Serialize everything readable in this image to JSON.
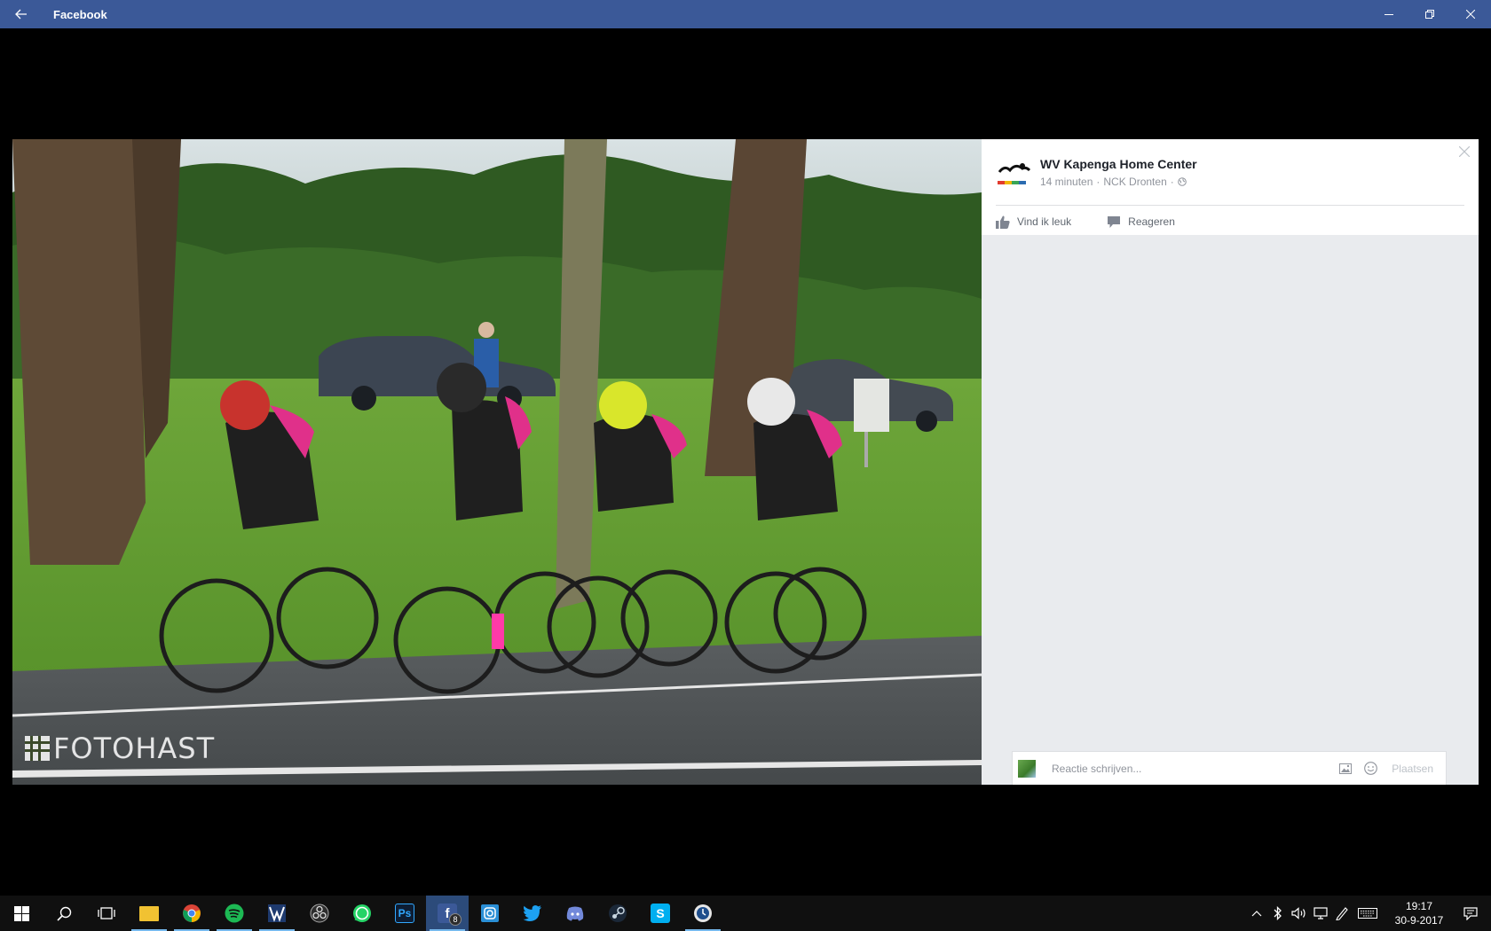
{
  "window": {
    "title": "Facebook"
  },
  "photo": {
    "watermark": "FOTOHAST"
  },
  "post": {
    "page_name": "WV Kapenga Home Center",
    "time": "14 minuten",
    "separator": "·",
    "location": "NCK Dronten",
    "privacy_icon": "globe-icon",
    "logo_text_1": "WV Kapenga",
    "logo_text_2": "Home Center"
  },
  "actions": {
    "like_label": "Vind ik leuk",
    "comment_label": "Reageren"
  },
  "comment_box": {
    "placeholder": "Reactie schrijven...",
    "post_label": "Plaatsen"
  },
  "taskbar": {
    "apps": [
      {
        "name": "file-explorer",
        "icon": "folder-icon"
      },
      {
        "name": "chrome",
        "icon": "chrome-icon"
      },
      {
        "name": "spotify",
        "icon": "spotify-icon"
      },
      {
        "name": "video-editor",
        "icon": "clapper-icon"
      },
      {
        "name": "obs",
        "icon": "obs-icon"
      },
      {
        "name": "whatsapp",
        "icon": "whatsapp-icon"
      },
      {
        "name": "photoshop",
        "icon": "photoshop-icon",
        "label": "Ps"
      },
      {
        "name": "facebook",
        "icon": "facebook-icon",
        "badge": "8"
      },
      {
        "name": "instagram",
        "icon": "instagram-icon"
      },
      {
        "name": "twitter",
        "icon": "twitter-icon"
      },
      {
        "name": "discord",
        "icon": "discord-icon"
      },
      {
        "name": "steam",
        "icon": "steam-icon"
      },
      {
        "name": "skype",
        "icon": "skype-icon",
        "label": "S"
      },
      {
        "name": "clock-app",
        "icon": "clock-icon"
      }
    ],
    "clock_time": "19:17",
    "clock_date": "30-9-2017"
  },
  "colors": {
    "titlebar": "#3b5998",
    "panel_bg": "#e9ebee",
    "taskbar": "#101010"
  }
}
